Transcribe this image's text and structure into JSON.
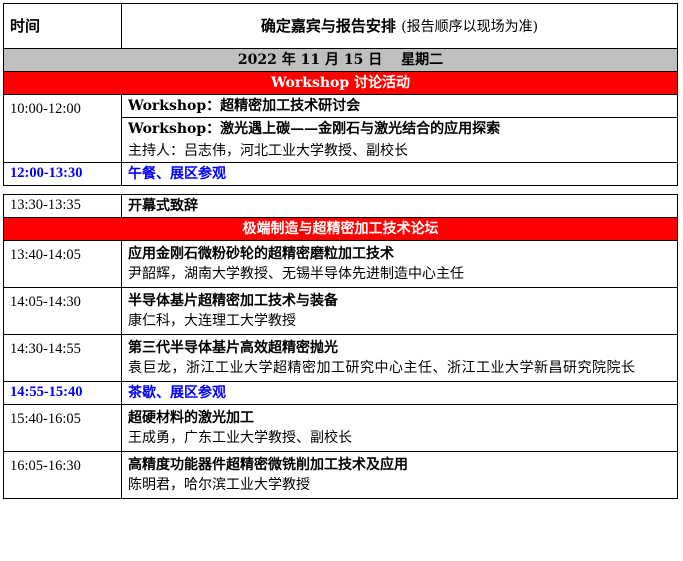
{
  "header": {
    "col_time": "时间",
    "col_topic": "确定嘉宾与报告安排",
    "col_note": "(报告顺序以现场为准)"
  },
  "date_row": "2022 年 11 月 15 日　 星期二",
  "section_workshop": "Workshop 讨论活动",
  "workshop": {
    "time": "10:00-12:00",
    "item1": "Workshop：超精密加工技术研讨会",
    "item2": "Workshop：激光遇上碳——金刚石与激光结合的应用探索",
    "host": "主持人：吕志伟，河北工业大学教授、副校长"
  },
  "lunch": {
    "time": "12:00-13:30",
    "label": "午餐、展区参观"
  },
  "opening": {
    "time": "13:30-13:35",
    "label": "开幕式致辞"
  },
  "section_forum": "极端制造与超精密加工技术论坛",
  "talks": [
    {
      "time": "13:40-14:05",
      "title": "应用金刚石微粉砂轮的超精密磨粒加工技术",
      "speaker": "尹韶辉，湖南大学教授、无锡半导体先进制造中心主任"
    },
    {
      "time": "14:05-14:30",
      "title": "半导体基片超精密加工技术与装备",
      "speaker": "康仁科，大连理工大学教授"
    },
    {
      "time": "14:30-14:55",
      "title": "第三代半导体基片高效超精密抛光",
      "speaker": "袁巨龙，浙江工业大学超精密加工研究中心主任、浙江工业大学新昌研究院院长"
    }
  ],
  "tea": {
    "time": "14:55-15:40",
    "label": "茶歇、展区参观"
  },
  "talks2": [
    {
      "time": "15:40-16:05",
      "title": "超硬材料的激光加工",
      "speaker": "王成勇，广东工业大学教授、副校长"
    },
    {
      "time": "16:05-16:30",
      "title": "高精度功能器件超精密微铣削加工技术及应用",
      "speaker": "陈明君，哈尔滨工业大学教授"
    }
  ]
}
